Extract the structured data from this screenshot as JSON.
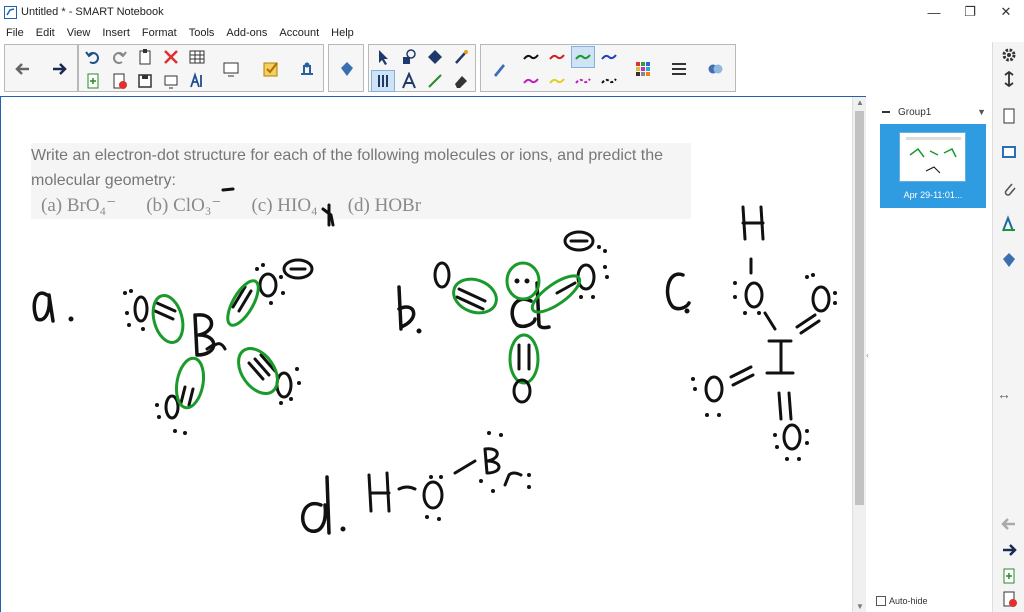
{
  "window": {
    "title": "Untitled * - SMART Notebook",
    "minimize_glyph": "—",
    "restore_glyph": "❐",
    "close_glyph": "✕"
  },
  "menu": [
    "File",
    "Edit",
    "View",
    "Insert",
    "Format",
    "Tools",
    "Add-ons",
    "Account",
    "Help"
  ],
  "page": {
    "question_text": "Write an electron-dot structure for each of the following molecules or ions, and predict the molecular geometry:",
    "parts": [
      "(a) BrO₄⁻",
      "(b) ClO₃⁻",
      "(c) HIO₄",
      "(d) HOBr"
    ]
  },
  "sidebar": {
    "group_label": "Group1",
    "group_arrow": "▼",
    "thumb_label": "Apr 29-11:01...",
    "auto_hide_label": "Auto-hide"
  },
  "colors": {
    "accent_blue": "#1e62b0",
    "thumb_blue": "#2f9be0",
    "ink_black": "#111111",
    "ink_green": "#1a9a2a"
  },
  "icons": {
    "toolbar": [
      "previous-page-icon",
      "next-page-icon",
      "undo-icon",
      "redo-icon",
      "paste-icon",
      "delete-icon",
      "table-icon",
      "screen-shade-icon",
      "add-page-icon",
      "delete-page-icon",
      "save-icon",
      "fullscreen-icon",
      "handwriting-icon",
      "document-camera-icon",
      "measurement-tools-icon",
      "response-icon",
      "select-icon",
      "shapes-icon",
      "fill-icon",
      "magic-pen-icon",
      "select-touch-icon",
      "text-icon",
      "line-icon",
      "eraser-icon",
      "pen-icon",
      "color-palette-icon",
      "properties-icon",
      "more-icon"
    ],
    "right_rail": [
      "settings-icon",
      "move-toolbar-icon",
      "page-sorter-icon",
      "gallery-icon",
      "attachments-icon",
      "properties-icon",
      "add-ons-icon",
      "previous-page-icon",
      "next-page-icon",
      "add-page-icon",
      "delete-page-icon"
    ]
  }
}
